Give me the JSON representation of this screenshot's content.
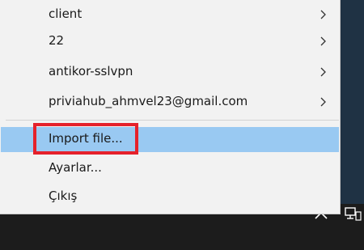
{
  "menu": {
    "items": [
      {
        "label": "client",
        "submenu": true
      },
      {
        "label": "22",
        "submenu": true
      },
      {
        "label": "antikor-sslvpn",
        "submenu": true
      },
      {
        "label": "priviahub_ahmvel23@gmail.com",
        "submenu": true
      },
      {
        "label": "Import file...",
        "submenu": false,
        "state": "hovered"
      },
      {
        "label": "Ayarlar...",
        "submenu": false
      },
      {
        "label": "Çıkış",
        "submenu": false
      }
    ]
  },
  "highlight_box": {
    "color": "#e5212b",
    "target": "import-file-menu-item"
  },
  "colors": {
    "menu_background": "#f2f2f2",
    "hover_background": "#99c9f2",
    "taskbar": "#1c1c1c",
    "desktop": "#1f3244"
  },
  "icons": {
    "submenu_arrow": "chevron-right-icon",
    "tray_overflow": "chevron-up-icon",
    "tray_network": "network-icon"
  }
}
